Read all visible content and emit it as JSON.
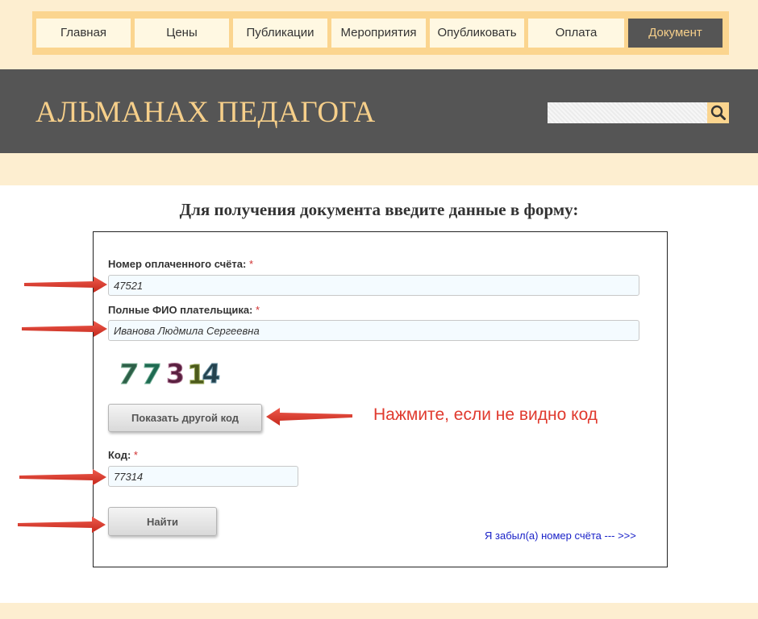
{
  "nav": {
    "items": [
      {
        "label": "Главная",
        "active": false
      },
      {
        "label": "Цены",
        "active": false
      },
      {
        "label": "Публикации",
        "active": false
      },
      {
        "label": "Мероприятия",
        "active": false
      },
      {
        "label": "Опубликовать",
        "active": false
      },
      {
        "label": "Оплата",
        "active": false
      },
      {
        "label": "Документ",
        "active": true
      }
    ]
  },
  "header": {
    "title": "АЛЬМАНАХ ПЕДАГОГА",
    "search": {
      "value": "",
      "icon": "search-icon"
    }
  },
  "main": {
    "heading": "Для получения документа введите данные в форму:"
  },
  "form": {
    "invoice_label": "Номер оплаченного счёта:",
    "invoice_value": "47521",
    "payer_label": "Полные ФИО плательщика:",
    "payer_value": "Иванова Людмила Сергеевна",
    "required_mark": "*",
    "captcha_text": "77314",
    "show_other_code_label": "Показать другой код",
    "code_label": "Код:",
    "code_value": "77314",
    "find_button_label": "Найти",
    "forgot_link": "Я забыл(а) номер счёта --- >>>"
  },
  "annotations": {
    "hint": "Нажмите, если не видно код"
  },
  "colors": {
    "accent": "#fbd58f",
    "header_bg": "#555555",
    "title": "#f6cf8a",
    "annotation_red": "#e03a2e",
    "link": "#1a22c8"
  }
}
